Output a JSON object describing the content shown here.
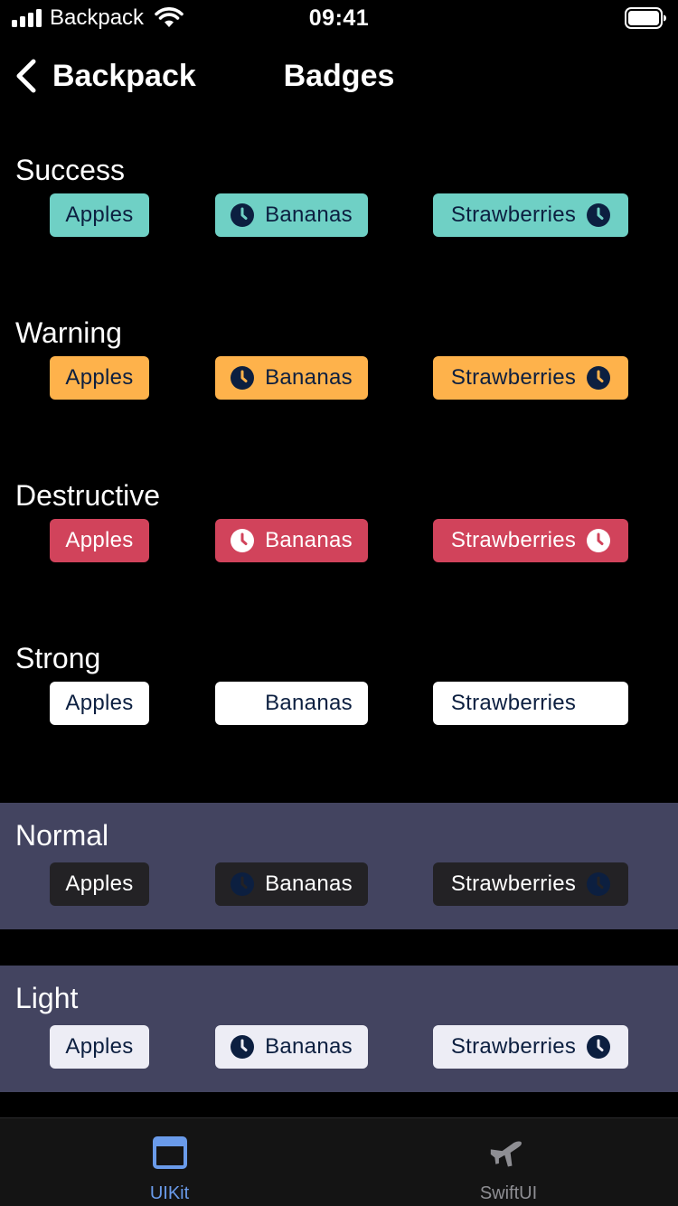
{
  "status_bar": {
    "carrier": "Backpack",
    "time": "09:41",
    "signal_icon": "cellular-signal-icon",
    "wifi_icon": "wifi-icon",
    "battery_icon": "battery-icon"
  },
  "nav": {
    "back_label": "Backpack",
    "back_icon": "chevron-left-icon",
    "title": "Badges"
  },
  "badges": {
    "item_1": "Apples",
    "item_2": "Bananas",
    "item_3": "Strawberries",
    "icon": "clock-icon"
  },
  "sections": [
    {
      "title": "Success",
      "bg": "#6fd0c5",
      "fg": "#0c1f40",
      "icon_color": "#0c1f40",
      "icon_face": "#6fd0c5"
    },
    {
      "title": "Warning",
      "bg": "#feb24b",
      "fg": "#0c1f40",
      "icon_color": "#0c1f40",
      "icon_face": "#feb24b"
    },
    {
      "title": "Destructive",
      "bg": "#d1435b",
      "fg": "#ffffff",
      "icon_color": "#ffffff",
      "icon_face": "#d1435b"
    },
    {
      "title": "Strong",
      "bg": "#ffffff",
      "fg": "#0c1f40",
      "icon_color": "#ffffff",
      "icon_face": "#ffffff"
    },
    {
      "title": "Normal",
      "bg": "#232225",
      "fg": "#ffffff",
      "icon_color": "#0c1f40",
      "icon_face": "#232225",
      "section_bg": "#434460"
    },
    {
      "title": "Light",
      "bg": "#ededf5",
      "fg": "#0c1f40",
      "icon_color": "#0c1f40",
      "icon_face": "#ededf5",
      "section_bg": "#434460"
    }
  ],
  "tab_bar": {
    "tabs": [
      {
        "label": "UIKit",
        "icon": "window-icon",
        "selected": true,
        "color": "#6a9bea"
      },
      {
        "label": "SwiftUI",
        "icon": "airplane-icon",
        "selected": false,
        "color": "#8e8e93"
      }
    ]
  },
  "colors": {
    "background": "#000000",
    "shaded_section": "#434460",
    "tab_bar_bg": "#141414",
    "accent": "#6a9bea"
  }
}
